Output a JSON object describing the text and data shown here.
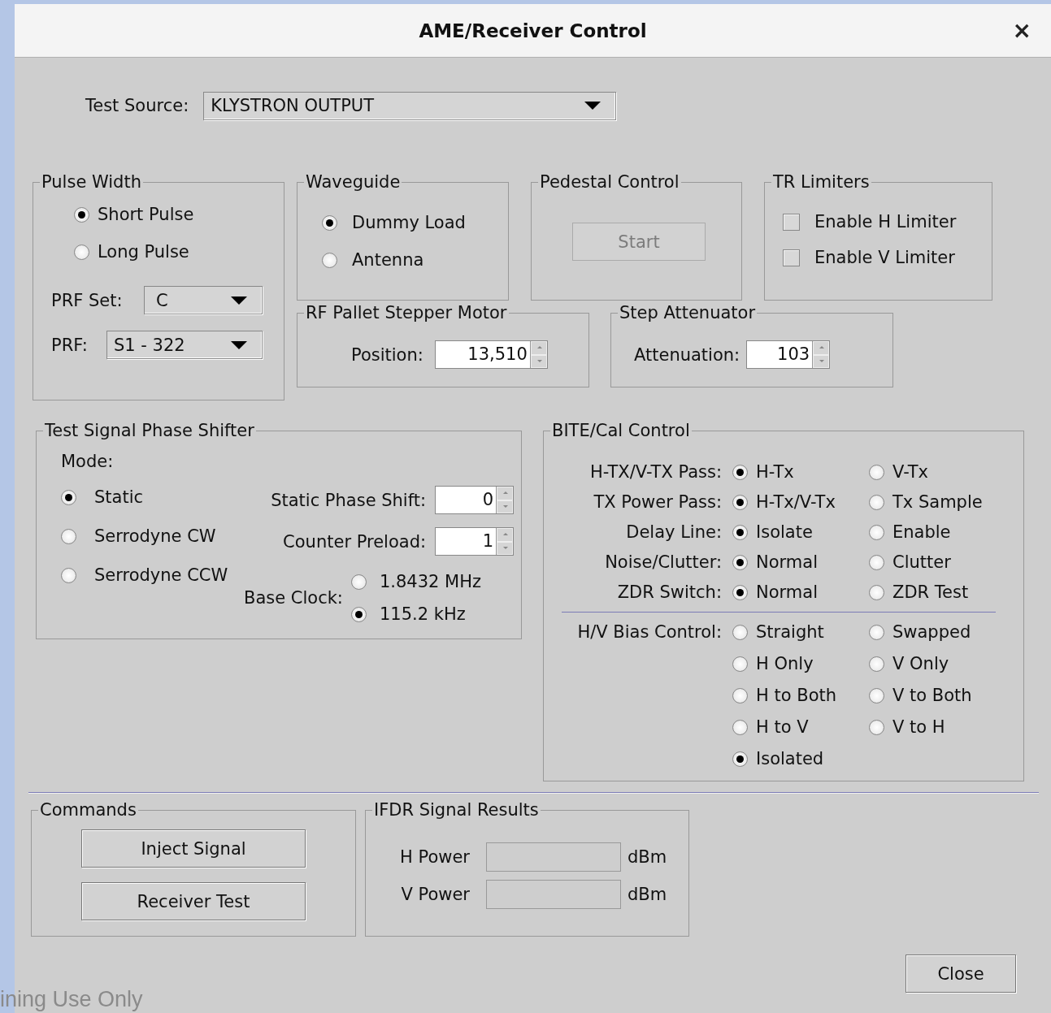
{
  "window": {
    "title": "AME/Receiver Control",
    "close": "×"
  },
  "test_source": {
    "label": "Test Source:",
    "value": "KLYSTRON OUTPUT"
  },
  "pulse_width": {
    "title": "Pulse Width",
    "options": [
      {
        "label": "Short Pulse",
        "selected": true
      },
      {
        "label": "Long Pulse",
        "selected": false
      }
    ],
    "prf_set": {
      "label": "PRF Set:",
      "value": "C"
    },
    "prf": {
      "label": "PRF:",
      "value": "S1 - 322"
    }
  },
  "waveguide": {
    "title": "Waveguide",
    "options": [
      {
        "label": "Dummy Load",
        "selected": true
      },
      {
        "label": "Antenna",
        "selected": false
      }
    ]
  },
  "pedestal_control": {
    "title": "Pedestal Control",
    "button": {
      "label": "Start",
      "disabled": true
    }
  },
  "tr_limiters": {
    "title": "TR Limiters",
    "items": [
      {
        "label": "Enable H Limiter",
        "checked": false
      },
      {
        "label": "Enable V Limiter",
        "checked": false
      }
    ]
  },
  "rf_pallet": {
    "title": "RF Pallet Stepper Motor",
    "label": "Position:",
    "value": "13,510"
  },
  "step_attenuator": {
    "title": "Step Attenuator",
    "label": "Attenuation:",
    "value": "103"
  },
  "phase_shifter": {
    "title": "Test Signal Phase Shifter",
    "mode_label": "Mode:",
    "modes": [
      {
        "label": "Static",
        "selected": true
      },
      {
        "label": "Serrodyne CW",
        "selected": false
      },
      {
        "label": "Serrodyne CCW",
        "selected": false
      }
    ],
    "fields": [
      {
        "label": "Static Phase Shift:",
        "value": "0"
      },
      {
        "label": "Counter Preload:",
        "value": "1"
      }
    ],
    "base_clock": {
      "label": "Base Clock:",
      "options": [
        {
          "label": "1.8432 MHz",
          "selected": false
        },
        {
          "label": "115.2 kHz",
          "selected": true
        }
      ]
    }
  },
  "bite_cal": {
    "title": "BITE/Cal Control",
    "rows": [
      {
        "label": "H-TX/V-TX Pass:",
        "options": [
          {
            "label": "H-Tx",
            "selected": true
          },
          {
            "label": "V-Tx",
            "selected": false
          }
        ]
      },
      {
        "label": "TX Power Pass:",
        "options": [
          {
            "label": "H-Tx/V-Tx",
            "selected": true
          },
          {
            "label": "Tx Sample",
            "selected": false
          }
        ]
      },
      {
        "label": "Delay Line:",
        "options": [
          {
            "label": "Isolate",
            "selected": true
          },
          {
            "label": "Enable",
            "selected": false
          }
        ]
      },
      {
        "label": "Noise/Clutter:",
        "options": [
          {
            "label": "Normal",
            "selected": true
          },
          {
            "label": "Clutter",
            "selected": false
          }
        ]
      },
      {
        "label": "ZDR Switch:",
        "options": [
          {
            "label": "Normal",
            "selected": true
          },
          {
            "label": "ZDR Test",
            "selected": false
          }
        ]
      }
    ],
    "bias": {
      "label": "H/V Bias Control:",
      "options": [
        {
          "label": "Straight",
          "selected": false
        },
        {
          "label": "Swapped",
          "selected": false
        },
        {
          "label": "H Only",
          "selected": false
        },
        {
          "label": "V Only",
          "selected": false
        },
        {
          "label": "H to Both",
          "selected": false
        },
        {
          "label": "V to Both",
          "selected": false
        },
        {
          "label": "H to V",
          "selected": false
        },
        {
          "label": "V to H",
          "selected": false
        },
        {
          "label": "Isolated",
          "selected": true
        }
      ]
    }
  },
  "commands": {
    "title": "Commands",
    "buttons": [
      "Inject Signal",
      "Receiver Test"
    ]
  },
  "ifdr": {
    "title": "IFDR Signal Results",
    "rows": [
      {
        "label": "H Power",
        "unit": "dBm"
      },
      {
        "label": "V Power",
        "unit": "dBm"
      }
    ]
  },
  "close_button": "Close",
  "background_text": "ining Use Only"
}
